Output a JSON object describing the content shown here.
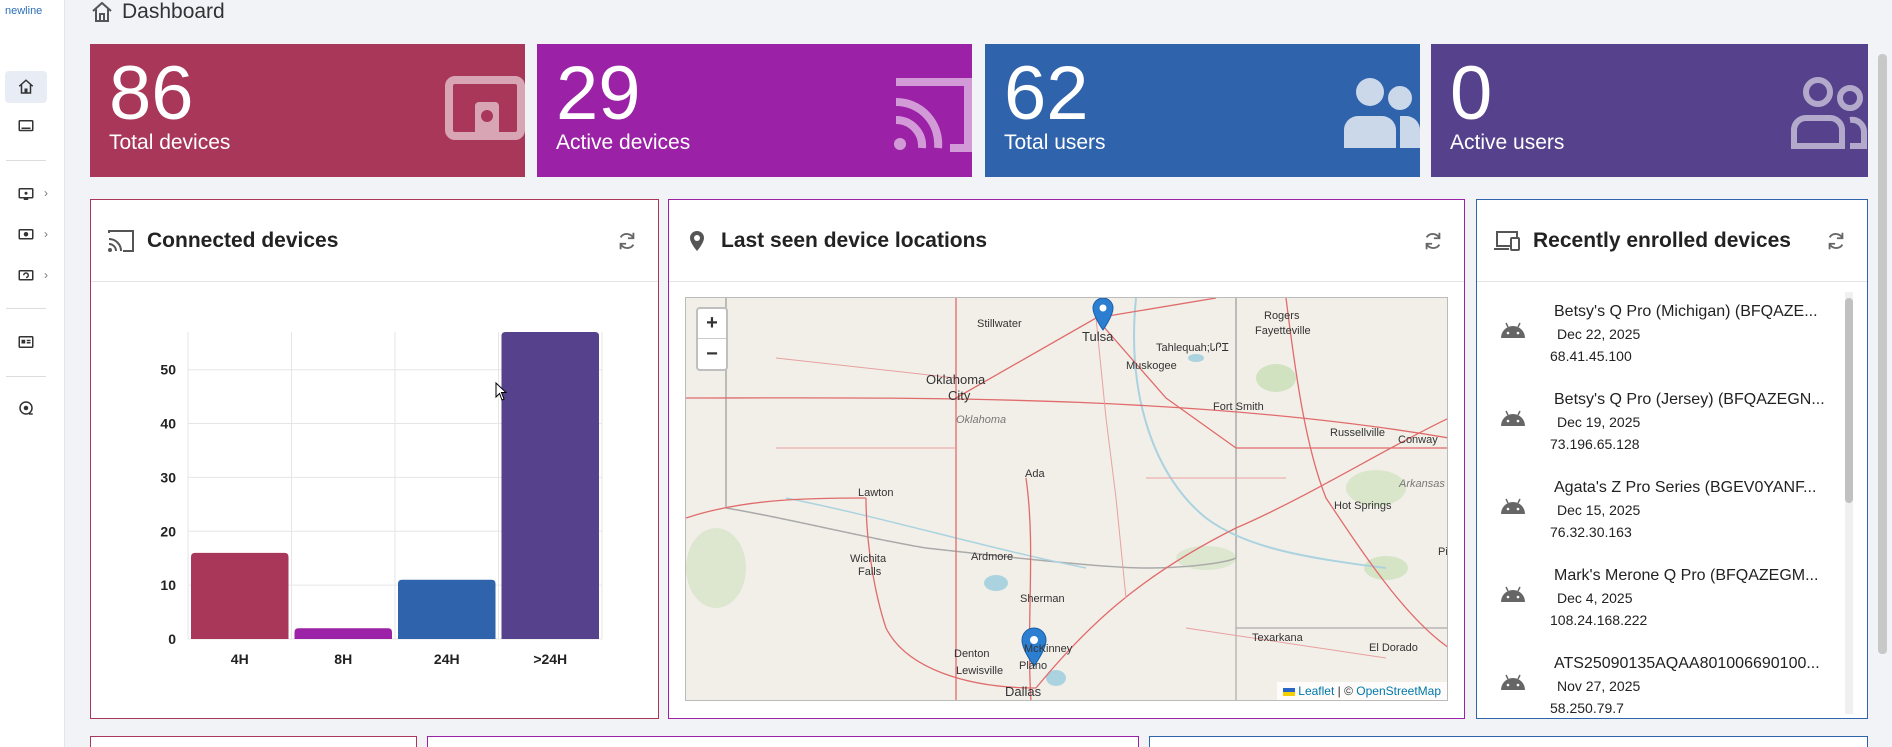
{
  "brand": "newline",
  "page": {
    "title": "Dashboard"
  },
  "stats": [
    {
      "value": "86",
      "label": "Total devices",
      "color": "#a8375a",
      "icon": "device-icon"
    },
    {
      "value": "29",
      "label": "Active devices",
      "color": "#9b22a6",
      "icon": "cast-icon"
    },
    {
      "value": "62",
      "label": "Total users",
      "color": "#2f63ab",
      "icon": "users-icon"
    },
    {
      "value": "0",
      "label": "Active users",
      "color": "#56428c",
      "icon": "users-outline-icon"
    }
  ],
  "connected": {
    "title": "Connected devices",
    "chart_data": {
      "type": "bar",
      "categories": [
        "4H",
        "8H",
        "24H",
        ">24H"
      ],
      "values": [
        16,
        2,
        11,
        57
      ],
      "colors": [
        "#a8375a",
        "#9b22a6",
        "#2f63ab",
        "#56428c"
      ],
      "yticks": [
        0,
        10,
        20,
        30,
        40,
        50
      ],
      "ylim": [
        0,
        57
      ]
    }
  },
  "locations": {
    "title": "Last seen device locations",
    "zoom_in": "+",
    "zoom_out": "−",
    "attrib_leaflet": "Leaflet",
    "attrib_sep": " | © ",
    "attrib_osm": "OpenStreetMap",
    "cities": {
      "stillwater": "Stillwater",
      "tulsa": "Tulsa",
      "rogers": "Rogers",
      "fayetteville": "Fayetteville",
      "tahlequah": "Tahlequah;ᏓᎵᏆ",
      "muskogee": "Muskogee",
      "okc1": "Oklahoma",
      "okc2": "City",
      "oklahoma_state": "Oklahoma",
      "fortsmith": "Fort Smith",
      "russellville": "Russellville",
      "conway": "Conway",
      "lawton": "Lawton",
      "ada": "Ada",
      "arkansas": "Arkansas",
      "hotsprings": "Hot Springs",
      "wichitafalls1": "Wichita",
      "wichitafalls2": "Falls",
      "ardmore": "Ardmore",
      "pi": "Pi",
      "sherman": "Sherman",
      "texarkana": "Texarkana",
      "eldorado": "El Dorado",
      "denton": "Denton",
      "mckinney": "McKinney",
      "lewisville": "Lewisville",
      "plano": "Plano",
      "dallas": "Dallas"
    }
  },
  "enrolled": {
    "title": "Recently enrolled devices",
    "items": [
      {
        "name": "Betsy's Q Pro (Michigan) (BFQAZE...",
        "date": "Dec 22, 2025",
        "ip": "68.41.45.100"
      },
      {
        "name": "Betsy's Q Pro (Jersey) (BFQAZEGN...",
        "date": "Dec 19, 2025",
        "ip": "73.196.65.128"
      },
      {
        "name": "Agata's Z Pro Series (BGEV0YANF...",
        "date": "Dec 15, 2025",
        "ip": "76.32.30.163"
      },
      {
        "name": "Mark's Merone Q Pro (BFQAZEGM...",
        "date": "Dec 4, 2025",
        "ip": "108.24.168.222"
      },
      {
        "name": "ATS25090135AQAA801006690100...",
        "date": "Nov 27, 2025",
        "ip": "58.250.79.7"
      }
    ]
  }
}
